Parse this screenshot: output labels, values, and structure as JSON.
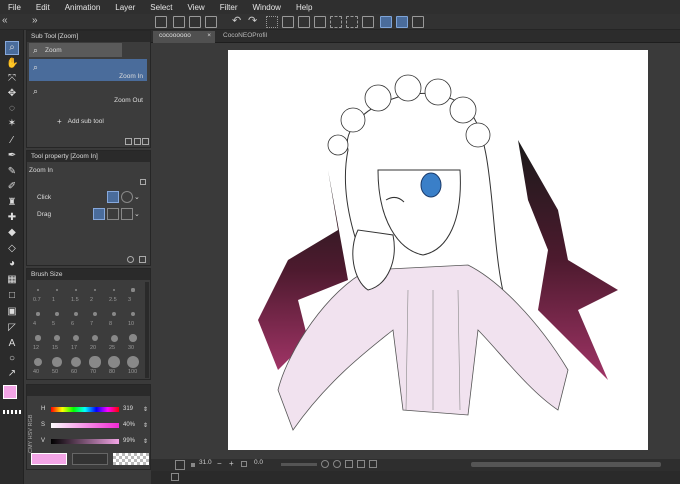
{
  "menu": [
    "File",
    "Edit",
    "Animation",
    "Layer",
    "Select",
    "View",
    "Filter",
    "Window",
    "Help"
  ],
  "subtool_panel": {
    "title": "Sub Tool [Zoom]",
    "tab": "Zoom",
    "items": [
      {
        "label": "Zoom In"
      },
      {
        "label": "Zoom Out"
      }
    ],
    "add_label": "Add sub tool"
  },
  "tool_property": {
    "title": "Tool property [Zoom In]",
    "tool_name": "Zoom In",
    "click_label": "Click",
    "drag_label": "Drag"
  },
  "brush_size": {
    "title": "Brush Size",
    "sizes": [
      "0.7",
      "1",
      "1.5",
      "2",
      "2.5",
      "3",
      "4",
      "5",
      "6",
      "7",
      "8",
      "10",
      "12",
      "15",
      "17",
      "20",
      "25",
      "30",
      "40",
      "50",
      "60",
      "70",
      "80",
      "100"
    ]
  },
  "color": {
    "h_label": "H",
    "h_value": "319",
    "s_label": "S",
    "s_value": "40%",
    "v_label": "V",
    "v_value": "99%",
    "mode_labels": "CMY HSV RGB",
    "main_color": "#f3a5e6"
  },
  "tabs": [
    {
      "label": "cocoooooo"
    },
    {
      "label": "CocoNEOProfil"
    }
  ],
  "status": {
    "zoom": "31.0",
    "angle": "0.0"
  }
}
